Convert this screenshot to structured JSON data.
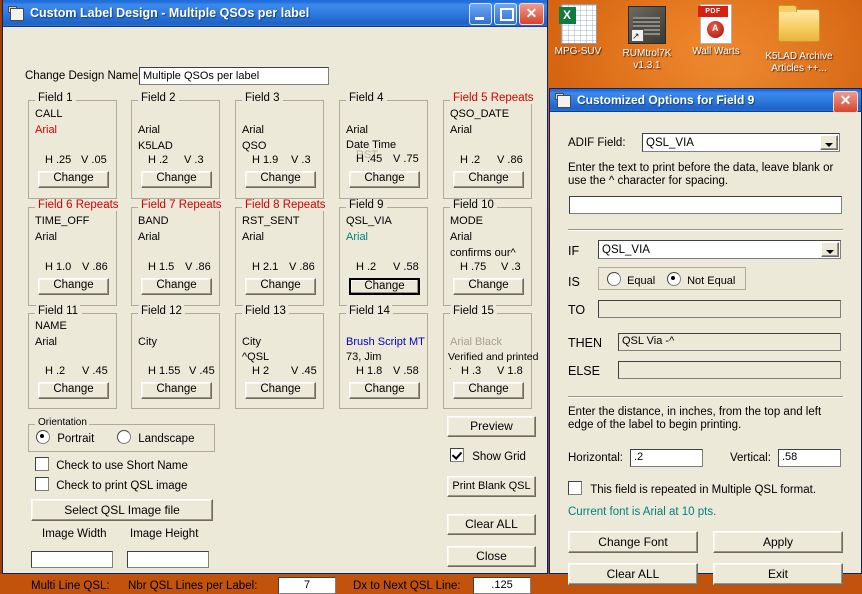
{
  "desktop": {
    "icons": [
      {
        "label": "MPG-SUV",
        "icon": "excel-spreadsheet-icon"
      },
      {
        "label": "RUMtrol7K\nv1.3.1",
        "label1": "RUMtrol7K",
        "label2": "v1.3.1",
        "icon": "radio-app-shortcut-icon"
      },
      {
        "label": "Wall Warts",
        "icon": "pdf-document-icon",
        "badge": "PDF"
      },
      {
        "label": "K5LAD Archive\nArticles ++...",
        "label1": "K5LAD Archive",
        "label2": "Articles ++...",
        "icon": "folder-icon"
      }
    ]
  },
  "main_window": {
    "title": "Custom Label Design - Multiple QSOs per label",
    "titlebar_icon": "window-document-icon",
    "buttons": {
      "minimize": "minimize-icon",
      "maximize": "maximize-icon",
      "close": "close-icon"
    },
    "design_name_label": "Change Design Name:",
    "design_name_value": "Multiple QSOs per label",
    "change_button_label": "Change",
    "fields": [
      {
        "caption": "Field 1",
        "repeats": false,
        "adif": "CALL",
        "font": "Arial",
        "font_color": "#d00000",
        "extra": "",
        "h": "H .25",
        "v": "V .05"
      },
      {
        "caption": "Field 2",
        "repeats": false,
        "adif": "",
        "font": "Arial",
        "font_color": "#000000",
        "extra": "K5LAD",
        "h": "H .2",
        "v": "V .3"
      },
      {
        "caption": "Field 3",
        "repeats": false,
        "adif": "",
        "font": "Arial",
        "font_color": "#000000",
        "extra": "QSO",
        "h": "H 1.9",
        "v": "V .3"
      },
      {
        "caption": "Field 4",
        "repeats": false,
        "adif": "",
        "font": "Arial",
        "font_color": "#000000",
        "extra": "Date            Time",
        "h": "H .45",
        "v": "V .75"
      },
      {
        "caption": "Field 5 Repeats",
        "repeats": true,
        "adif": "QSO_DATE",
        "font": "Arial",
        "font_color": "#000000",
        "extra": "",
        "h": "H .2",
        "v": "V .86"
      },
      {
        "caption": "Field 6 Repeats",
        "repeats": true,
        "adif": "TIME_OFF",
        "font": "Arial",
        "font_color": "#000000",
        "extra": "",
        "h": "H 1.0",
        "v": "V .86"
      },
      {
        "caption": "Field 7 Repeats",
        "repeats": true,
        "adif": "BAND",
        "font": "Arial",
        "font_color": "#000000",
        "extra": "",
        "h": "H 1.5",
        "v": "V .86"
      },
      {
        "caption": "Field 8 Repeats",
        "repeats": true,
        "adif": "RST_SENT",
        "font": "Arial",
        "font_color": "#000000",
        "extra": "",
        "h": "H 2.1",
        "v": "V .86"
      },
      {
        "caption": "Field 9",
        "repeats": false,
        "adif": "QSL_VIA",
        "font": "Arial",
        "font_color": "#008080",
        "extra": "",
        "h": "H .2",
        "v": "V .58",
        "focused": true
      },
      {
        "caption": "Field 10",
        "repeats": false,
        "adif": "MODE",
        "font": "Arial",
        "font_color": "#000000",
        "extra": "confirms our^",
        "h": "H .75",
        "v": "V .3"
      },
      {
        "caption": "Field 11",
        "repeats": false,
        "adif": "NAME",
        "font": "Arial",
        "font_color": "#000000",
        "extra": "",
        "h": "H .2",
        "v": "V .45"
      },
      {
        "caption": "Field 12",
        "repeats": false,
        "adif": "",
        "font": "City",
        "font_color": "#000000",
        "extra": "",
        "h": "H 1.55",
        "v": "V .45"
      },
      {
        "caption": "Field 13",
        "repeats": false,
        "adif": "",
        "font": "City",
        "font_color": "#000000",
        "extra": "^QSL",
        "h": "H 2",
        "v": "V .45"
      },
      {
        "caption": "Field 14",
        "repeats": false,
        "adif": "",
        "font": "Brush Script MT",
        "font_color": "#0000c0",
        "extra": "73, Jim",
        "h": "H 1.8",
        "v": "V .58"
      },
      {
        "caption": "Field 15",
        "repeats": false,
        "adif": "",
        "font": "Arial Black",
        "font_color": "#a6a08e",
        "extra": "Verified and printed",
        "h": "H .3",
        "v": "V 1.8"
      }
    ],
    "orientation": {
      "caption": "Orientation",
      "options": [
        {
          "label": "Portrait",
          "selected": true
        },
        {
          "label": "Landscape",
          "selected": false
        }
      ]
    },
    "checkboxes": [
      {
        "label": "Check to use Short Name",
        "checked": false
      },
      {
        "label": "Check to print QSL image",
        "checked": false
      }
    ],
    "select_image_button": "Select QSL Image file",
    "image_width_label": "Image Width",
    "image_height_label": "Image Height",
    "image_width_value": "",
    "image_height_value": "",
    "multi_line_label": "Multi Line QSL:",
    "nbr_lines_label": "Nbr QSL Lines per Label:",
    "nbr_lines_value": "7",
    "dx_label": "Dx to Next QSL Line:",
    "dx_value": ".125",
    "right_buttons": [
      {
        "label": "Preview",
        "name": "preview-button"
      },
      {
        "label": "Print Blank QSL",
        "name": "print-blank-qsl-button"
      },
      {
        "label": "Clear ALL",
        "name": "clear-all-button"
      },
      {
        "label": "Close",
        "name": "close-button"
      }
    ],
    "show_grid": {
      "label": "Show Grid",
      "checked": true
    }
  },
  "dialog": {
    "title": "Customized Options for Field 9",
    "titlebar_icon": "window-document-icon",
    "close_icon": "close-icon",
    "adif_label": "ADIF Field:",
    "adif_value": "QSL_VIA",
    "prefix_help": "Enter the text to print before the data, leave blank or use the ^ character for spacing.",
    "prefix_value": "",
    "if_label": "IF",
    "if_value": "QSL_VIA",
    "is_label": "IS",
    "is_options": [
      {
        "label": "Equal",
        "selected": false
      },
      {
        "label": "Not Equal",
        "selected": true
      }
    ],
    "to_label": "TO",
    "to_value": "",
    "then_label": "THEN",
    "then_value": "QSL Via -^",
    "else_label": "ELSE",
    "else_value": "",
    "distance_help": "Enter the distance, in inches, from the top and left edge of the label to begin printing.",
    "horizontal_label": "Horizontal:",
    "horizontal_value": ".2",
    "vertical_label": "Vertical:",
    "vertical_value": ".58",
    "repeat_checkbox": {
      "label": "This field is repeated in Multiple QSL format.",
      "checked": false
    },
    "current_font_note": "Current font is Arial at 10 pts.",
    "buttons": [
      {
        "label": "Change Font",
        "name": "change-font-button"
      },
      {
        "label": "Apply",
        "name": "apply-button"
      },
      {
        "label": "Clear ALL",
        "name": "dialog-clear-all-button"
      },
      {
        "label": "Exit",
        "name": "exit-button"
      }
    ]
  },
  "colors": {
    "window_face": "#ece9d8",
    "title_blue": "#2f7ce2",
    "red_caption": "#d00000",
    "teal": "#008080",
    "desktop_orange": "#c1530d"
  }
}
